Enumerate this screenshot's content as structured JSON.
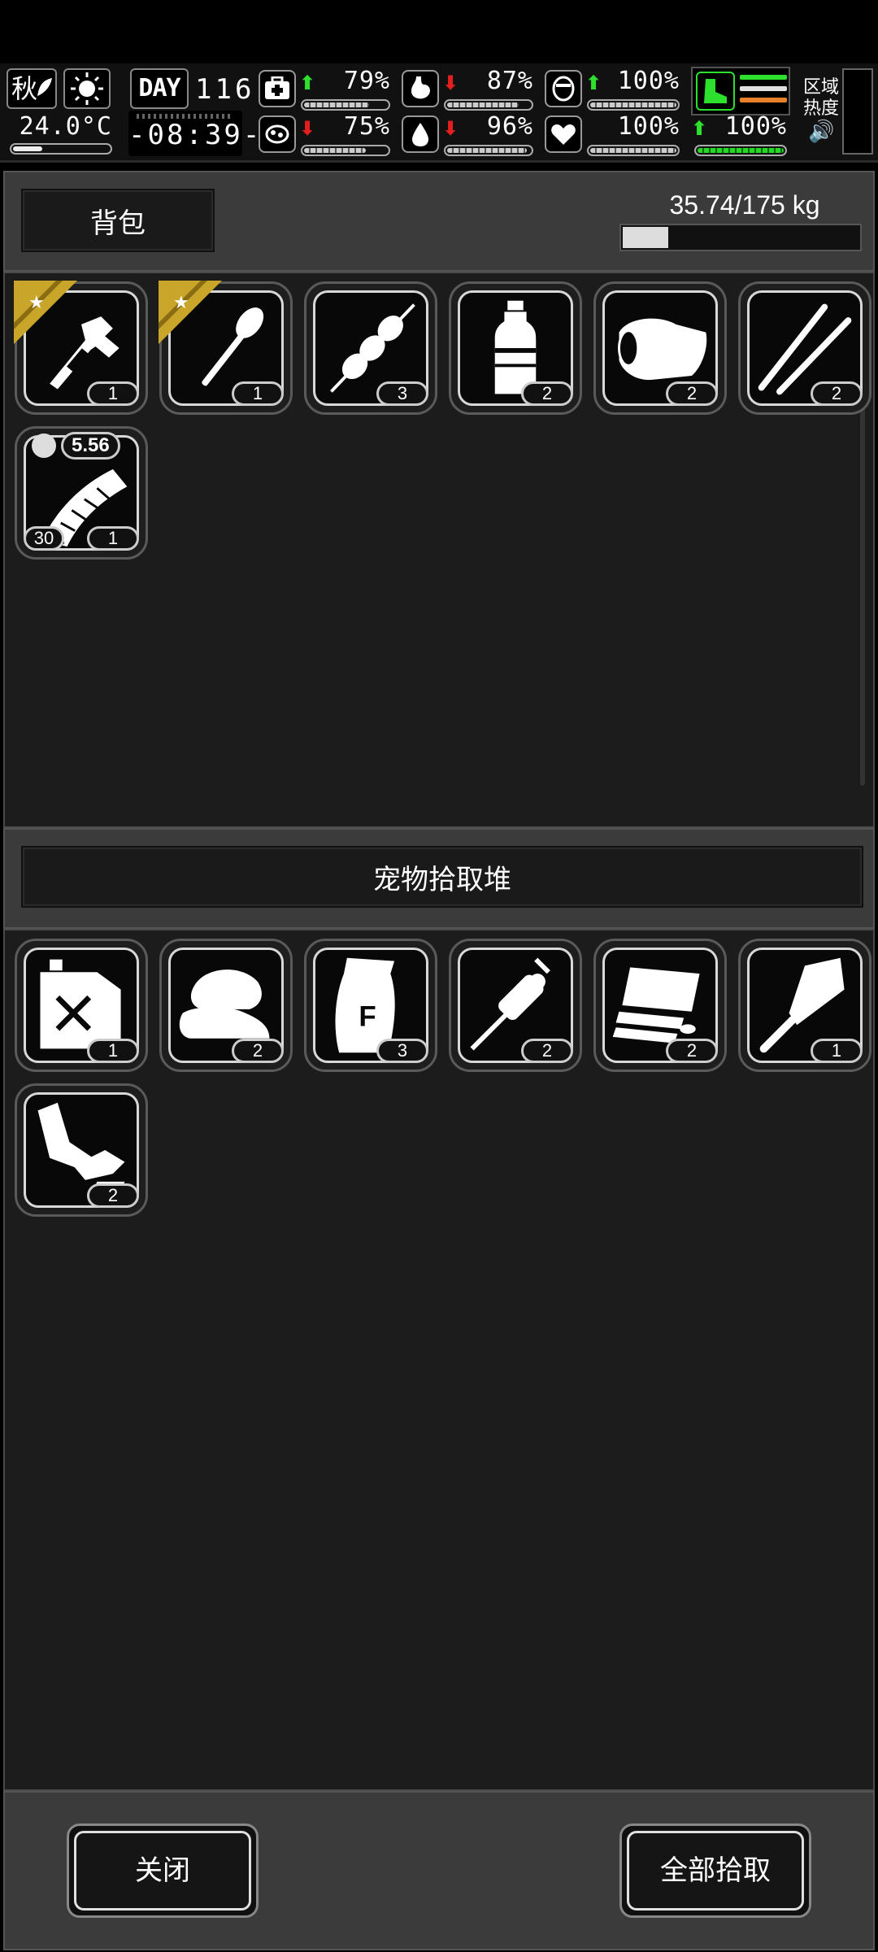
{
  "hud": {
    "season": "秋",
    "temperature": "24.0°C",
    "day_label": "DAY",
    "day_number": "116",
    "time": "-08:39-",
    "stats": [
      {
        "name": "health",
        "trend": "up",
        "value": "79%",
        "level": 0.79
      },
      {
        "name": "hunger",
        "trend": "down",
        "value": "87%",
        "level": 0.87
      },
      {
        "name": "stamina",
        "trend": "up",
        "value": "100%",
        "level": 1.0
      },
      {
        "name": "immunity",
        "trend": "down",
        "value": "75%",
        "level": 0.75
      },
      {
        "name": "thirst",
        "trend": "down",
        "value": "96%",
        "level": 0.96
      },
      {
        "name": "mood",
        "trend": "none",
        "value": "100%",
        "level": 1.0
      },
      {
        "name": "energy",
        "trend": "up",
        "value": "100%",
        "level": 1.0
      }
    ],
    "zone_label": "区域热度"
  },
  "backpack": {
    "title": "背包",
    "weight": "35.74/175 kg",
    "weight_fraction": 0.204,
    "items": [
      {
        "icon": "tool-icon",
        "count": "1",
        "starred": true
      },
      {
        "icon": "shovel-icon",
        "count": "1",
        "starred": true
      },
      {
        "icon": "meat-skewer-icon",
        "count": "3",
        "starred": false
      },
      {
        "icon": "water-bottle-icon",
        "count": "2",
        "starred": false
      },
      {
        "icon": "cloth-icon",
        "count": "2",
        "starred": false
      },
      {
        "icon": "sticks-icon",
        "count": "2",
        "starred": false
      },
      {
        "icon": "ammo-magazine-icon",
        "count": "1",
        "ammo": "30",
        "caliber": "5.56",
        "starred": false
      }
    ]
  },
  "pickup": {
    "title": "宠物拾取堆",
    "items": [
      {
        "icon": "fuel-can-icon",
        "count": "1"
      },
      {
        "icon": "fabric-pile-icon",
        "count": "2"
      },
      {
        "icon": "flour-bag-icon",
        "count": "3"
      },
      {
        "icon": "hand-drill-icon",
        "count": "2"
      },
      {
        "icon": "planks-icon",
        "count": "2"
      },
      {
        "icon": "cleaver-icon",
        "count": "1"
      },
      {
        "icon": "scrap-parts-icon",
        "count": "2"
      }
    ]
  },
  "footer": {
    "close_label": "关闭",
    "pickup_all_label": "全部拾取"
  },
  "colors": {
    "panel": "#3a3b3a",
    "grid": "#1c1c1c",
    "up": "#2ee02e",
    "down": "#e21e1e",
    "gold": "#c9a52a"
  }
}
